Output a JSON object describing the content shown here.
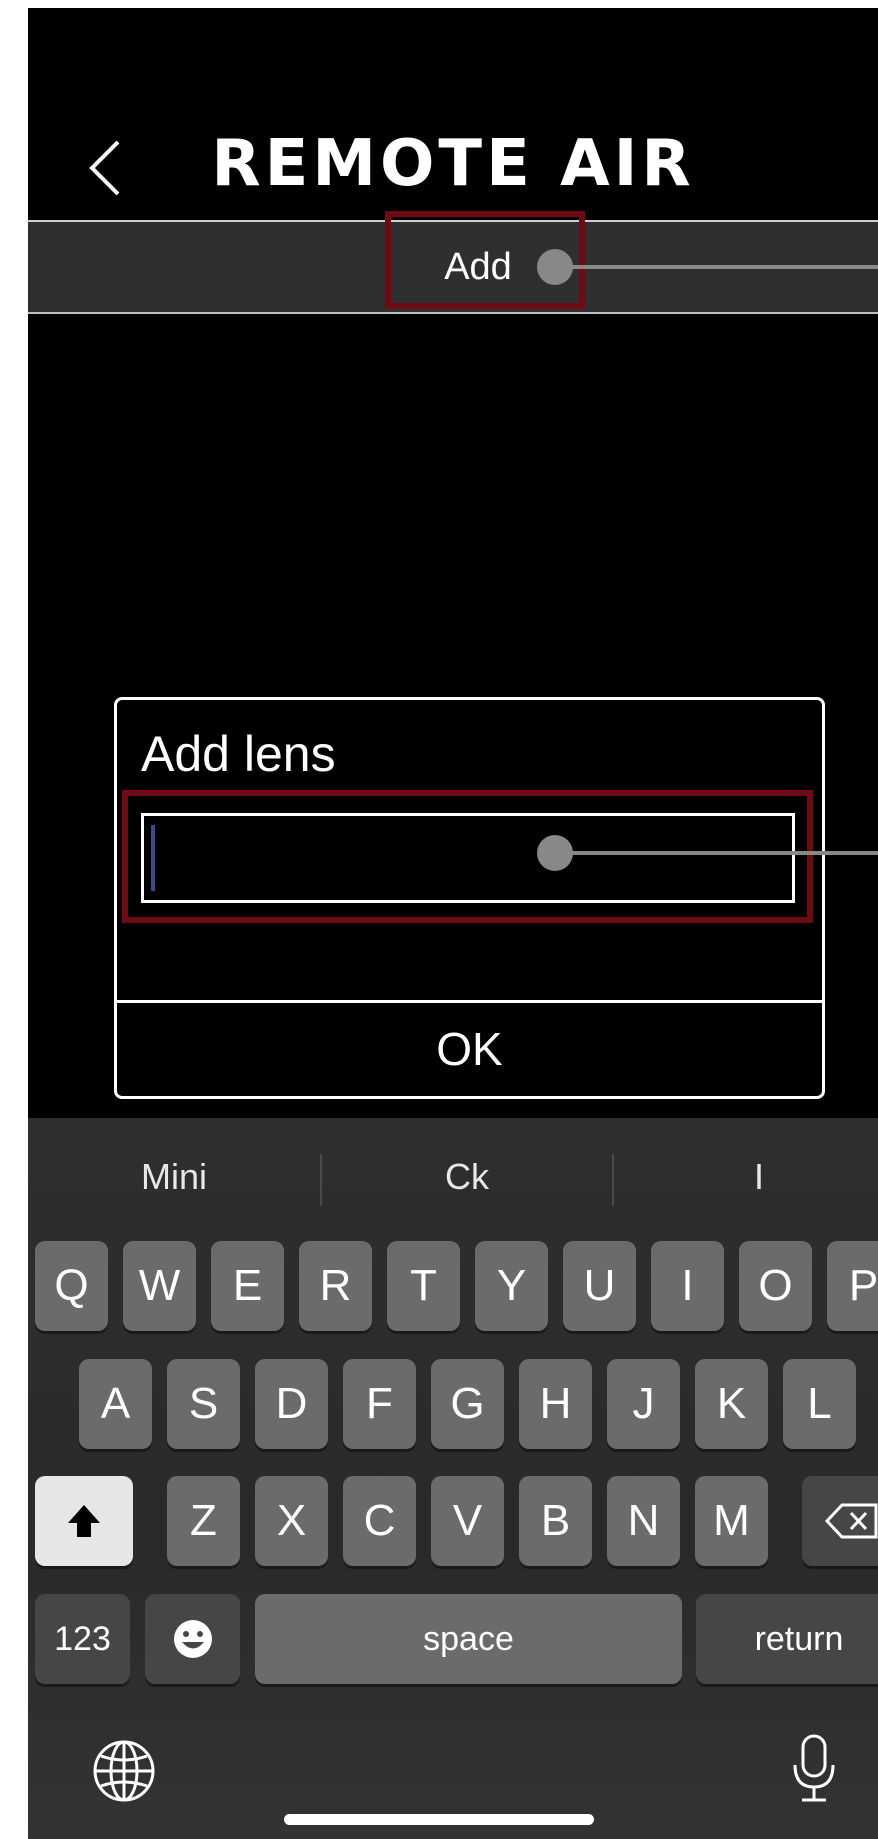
{
  "header": {
    "title": "REMOTE AIR",
    "back_icon": "chevron-left-icon"
  },
  "add_bar": {
    "add_label": "Add"
  },
  "dialog": {
    "title": "Add lens",
    "input_value": "",
    "ok_label": "OK"
  },
  "keyboard": {
    "suggestions": [
      "Mini",
      "Ck",
      "I"
    ],
    "row1": [
      "Q",
      "W",
      "E",
      "R",
      "T",
      "Y",
      "U",
      "I",
      "O",
      "P"
    ],
    "row2": [
      "A",
      "S",
      "D",
      "F",
      "G",
      "H",
      "J",
      "K",
      "L"
    ],
    "row3": [
      "Z",
      "X",
      "C",
      "V",
      "B",
      "N",
      "M"
    ],
    "numbers_label": "123",
    "space_label": "space",
    "return_label": "return",
    "icons": {
      "shift": "shift-icon",
      "delete": "delete-icon",
      "emoji": "emoji-icon",
      "globe": "globe-icon",
      "mic": "microphone-icon"
    }
  },
  "colors": {
    "highlight": "#6f0a14",
    "callout": "#888888",
    "background": "#000000"
  }
}
